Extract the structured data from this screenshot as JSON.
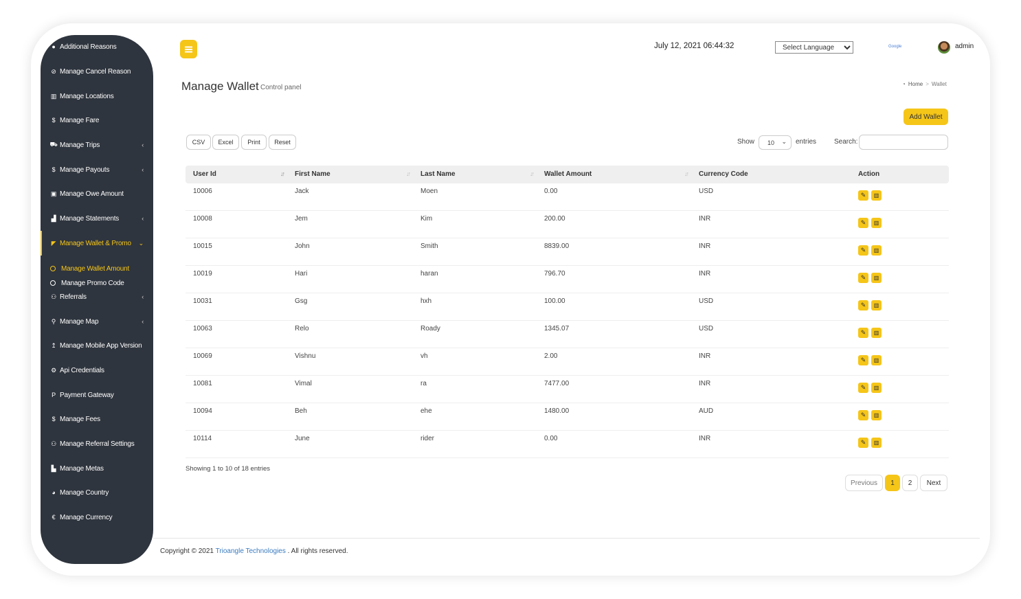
{
  "header": {
    "datetime": "July 12, 2021 06:44:32",
    "language_select": "Select Language",
    "google_label": "Google",
    "user_name": "admin"
  },
  "sidebar": {
    "items": [
      {
        "label": "Additional Reasons",
        "icon": "comment-icon",
        "glyph": "●",
        "chevron": false
      },
      {
        "label": "Manage Cancel Reason",
        "icon": "ban-icon",
        "glyph": "⊘",
        "chevron": false
      },
      {
        "label": "Manage Locations",
        "icon": "map-icon",
        "glyph": "▥",
        "chevron": false
      },
      {
        "label": "Manage Fare",
        "icon": "dollar-icon",
        "glyph": "$",
        "chevron": false
      },
      {
        "label": "Manage Trips",
        "icon": "car-icon",
        "glyph": "⛟",
        "chevron": true
      },
      {
        "label": "Manage Payouts",
        "icon": "dollar-icon",
        "glyph": "$",
        "chevron": true
      },
      {
        "label": "Manage Owe Amount",
        "icon": "money-icon",
        "glyph": "▣",
        "chevron": false
      },
      {
        "label": "Manage Statements",
        "icon": "area-chart-icon",
        "glyph": "▟",
        "chevron": true
      },
      {
        "label": "Manage Wallet & Promo",
        "icon": "wallet-icon",
        "glyph": "◤",
        "chevron": true,
        "active": true,
        "expanded": true
      },
      {
        "label": "Referrals",
        "icon": "users-icon",
        "glyph": "⚇",
        "chevron": true
      },
      {
        "label": "Manage Map",
        "icon": "map-marker-icon",
        "glyph": "⚲",
        "chevron": true
      },
      {
        "label": "Manage Mobile App Version",
        "icon": "upload-icon",
        "glyph": "↥",
        "chevron": false
      },
      {
        "label": "Api Credentials",
        "icon": "gear-icon",
        "glyph": "⚙",
        "chevron": false
      },
      {
        "label": "Payment Gateway",
        "icon": "paypal-icon",
        "glyph": "P",
        "chevron": false
      },
      {
        "label": "Manage Fees",
        "icon": "dollar-icon",
        "glyph": "$",
        "chevron": false
      },
      {
        "label": "Manage Referral Settings",
        "icon": "users-icon",
        "glyph": "⚇",
        "chevron": false
      },
      {
        "label": "Manage Metas",
        "icon": "bar-chart-icon",
        "glyph": "▙",
        "chevron": false
      },
      {
        "label": "Manage Country",
        "icon": "globe-icon",
        "glyph": "◕",
        "chevron": false
      },
      {
        "label": "Manage Currency",
        "icon": "euro-icon",
        "glyph": "€",
        "chevron": false
      }
    ],
    "subitems": [
      {
        "label": "Manage Wallet Amount",
        "active": true
      },
      {
        "label": "Manage Promo Code",
        "active": false
      }
    ]
  },
  "page": {
    "title": "Manage Wallet",
    "subtitle": "Control panel",
    "breadcrumb": {
      "home": "Home",
      "current": "Wallet"
    },
    "add_button": "Add Wallet"
  },
  "toolbar": {
    "export_buttons": [
      "CSV",
      "Excel",
      "Print",
      "Reset"
    ],
    "show_label": "Show",
    "page_length": "10",
    "entries_label": "entries",
    "search_label": "Search:",
    "search_value": ""
  },
  "table": {
    "columns": [
      "User Id",
      "First Name",
      "Last Name",
      "Wallet Amount",
      "Currency Code",
      "Action"
    ],
    "rows": [
      {
        "user_id": "10006",
        "first_name": "Jack",
        "last_name": "Moen",
        "wallet_amount": "0.00",
        "currency": "USD"
      },
      {
        "user_id": "10008",
        "first_name": "Jem",
        "last_name": "Kim",
        "wallet_amount": "200.00",
        "currency": "INR"
      },
      {
        "user_id": "10015",
        "first_name": "John",
        "last_name": "Smith",
        "wallet_amount": "8839.00",
        "currency": "INR"
      },
      {
        "user_id": "10019",
        "first_name": "Hari",
        "last_name": "haran",
        "wallet_amount": "796.70",
        "currency": "INR"
      },
      {
        "user_id": "10031",
        "first_name": "Gsg",
        "last_name": "hxh",
        "wallet_amount": "100.00",
        "currency": "USD"
      },
      {
        "user_id": "10063",
        "first_name": "Relo",
        "last_name": "Roady",
        "wallet_amount": "1345.07",
        "currency": "USD"
      },
      {
        "user_id": "10069",
        "first_name": "Vishnu",
        "last_name": "vh",
        "wallet_amount": "2.00",
        "currency": "INR"
      },
      {
        "user_id": "10081",
        "first_name": "Vimal",
        "last_name": "ra",
        "wallet_amount": "7477.00",
        "currency": "INR"
      },
      {
        "user_id": "10094",
        "first_name": "Beh",
        "last_name": "ehe",
        "wallet_amount": "1480.00",
        "currency": "AUD"
      },
      {
        "user_id": "10114",
        "first_name": "June",
        "last_name": "rider",
        "wallet_amount": "0.00",
        "currency": "INR"
      }
    ],
    "info": "Showing 1 to 10 of 18 entries"
  },
  "pagination": {
    "previous": "Previous",
    "pages": [
      "1",
      "2"
    ],
    "current_page": "1",
    "next": "Next"
  },
  "footer": {
    "prefix": "Copyright © 2021",
    "company": "Trioangle Technologies",
    "suffix": ". All rights reserved."
  },
  "colors": {
    "accent": "#f5c518",
    "sidebar_bg": "#2f353e",
    "link": "#3a7bbf"
  }
}
